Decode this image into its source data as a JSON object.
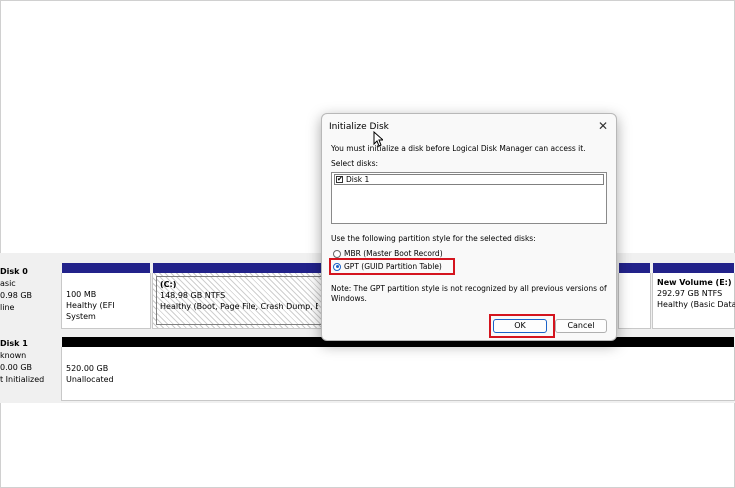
{
  "disks": [
    {
      "label_lines": [
        "Disk 0",
        "asic",
        "0.98 GB",
        "line"
      ],
      "partitions": [
        {
          "lines": [
            "100 MB",
            "Healthy (EFI System"
          ]
        },
        {
          "title": "(C:)",
          "lines": [
            "148.98 GB NTFS",
            "Healthy (Boot, Page File, Crash Dump, Bas"
          ]
        },
        {
          "title": "New Volume  (E:)",
          "lines": [
            "292.97 GB NTFS",
            "Healthy (Basic Data"
          ]
        }
      ]
    },
    {
      "label_lines": [
        "Disk 1",
        "known",
        "0.00 GB",
        "t Initialized"
      ],
      "partitions": [
        {
          "lines": [
            "520.00 GB",
            "Unallocated"
          ]
        }
      ]
    }
  ],
  "dialog": {
    "title": "Initialize Disk",
    "close_glyph": "✕",
    "message": "You must initialize a disk before Logical Disk Manager can access it.",
    "select_label": "Select disks:",
    "disk_items": [
      {
        "label": "Disk 1",
        "checked": "✔"
      }
    ],
    "partition_prompt": "Use the following partition style for the selected disks:",
    "options": [
      {
        "label": "MBR (Master Boot Record)",
        "selected": false
      },
      {
        "label": "GPT (GUID Partition Table)",
        "selected": true
      }
    ],
    "note": "Note: The GPT partition style is not recognized by all previous versions of Windows.",
    "ok_label": "OK",
    "cancel_label": "Cancel"
  },
  "colors": {
    "partition_bar": "#22228a",
    "unallocated_bar": "#000000",
    "highlight": "#d4141e",
    "radio_accent": "#1a62c8"
  }
}
